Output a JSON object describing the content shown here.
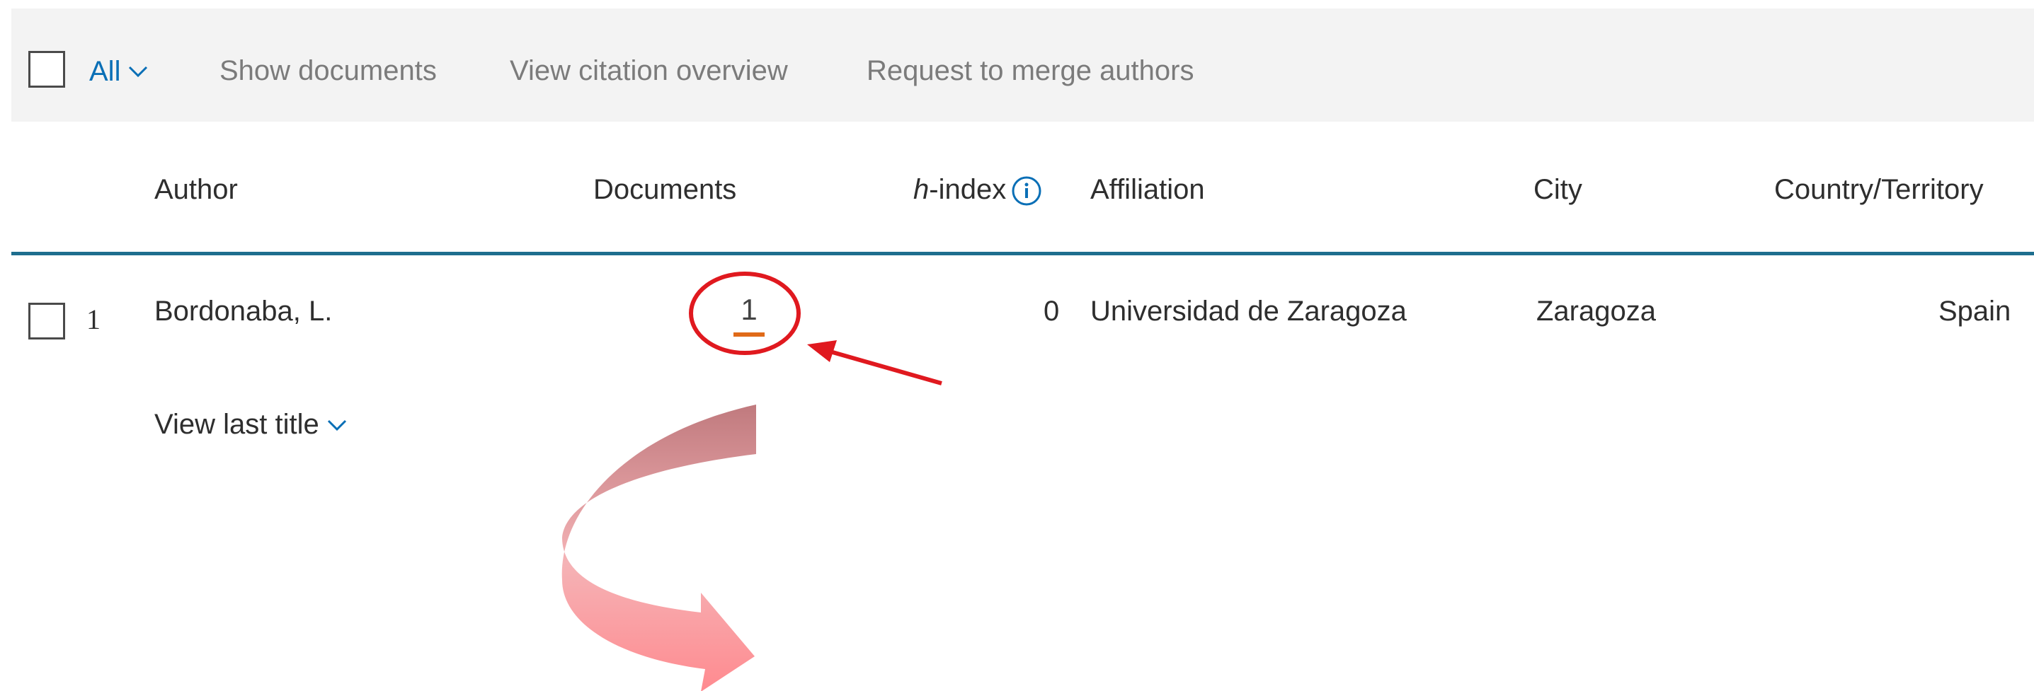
{
  "toolbar": {
    "select_all_label": "All",
    "actions": [
      "Show documents",
      "View citation overview",
      "Request to merge authors"
    ]
  },
  "table": {
    "headers": {
      "author": "Author",
      "documents": "Documents",
      "h_index_prefix": "h",
      "h_index_suffix": "-index",
      "affiliation": "Affiliation",
      "city": "City",
      "country": "Country/Territory"
    },
    "rows": [
      {
        "number": "1",
        "author": "Bordonaba, L.",
        "documents": "1",
        "h_index": "0",
        "affiliation": "Universidad de Zaragoza",
        "city": "Zaragoza",
        "country": "Spain",
        "view_last_title": "View last title"
      }
    ]
  },
  "colors": {
    "link_blue": "#0a6fb6",
    "divider": "#1e6e8e",
    "annotation_red": "#e0191f",
    "underline_orange": "#e06a18"
  },
  "icons": [
    "chevron-down-icon",
    "info-icon"
  ]
}
